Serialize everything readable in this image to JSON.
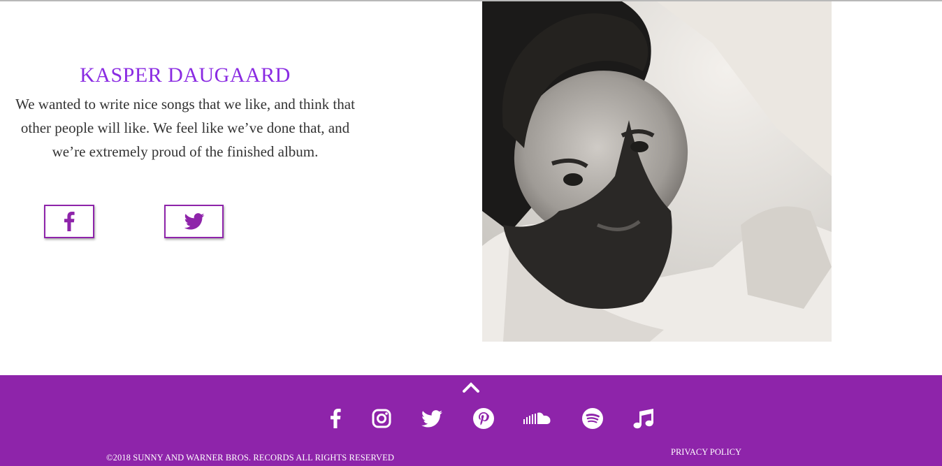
{
  "bio": {
    "name": "KASPER DAUGAARD",
    "quote": "We wanted to write nice songs that we like, and think that other people will like. We feel like we’ve done that, and we’re extremely proud of the finished album."
  },
  "social_buttons": [
    {
      "icon": "facebook-icon"
    },
    {
      "icon": "twitter-icon"
    }
  ],
  "footer": {
    "icons": [
      "facebook-icon",
      "instagram-icon",
      "twitter-icon",
      "pinterest-icon",
      "soundcloud-icon",
      "spotify-icon",
      "music-note-icon"
    ],
    "copyright": "©2018 SUNNY AND WARNER BROS. RECORDS ALL RIGHTS RESERVED",
    "privacy": "PRIVACY POLICY"
  },
  "colors": {
    "accent": "#8e24aa",
    "name_purple": "#8a2be2",
    "text": "#333333"
  }
}
